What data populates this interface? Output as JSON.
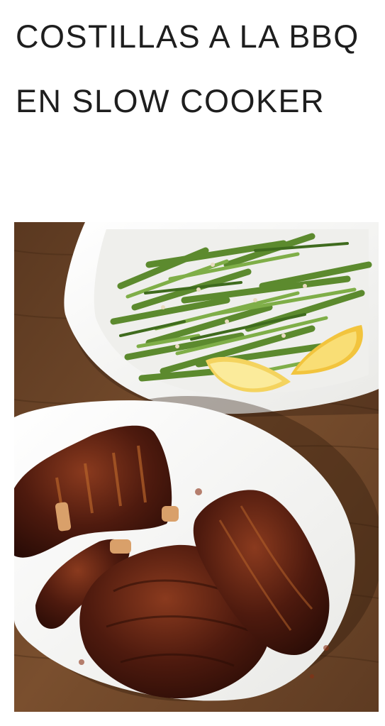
{
  "recipe": {
    "title": "COSTILLAS A LA BBQ EN SLOW COOKER"
  },
  "photo": {
    "subject": "bbq-ribs-and-green-beans",
    "colors": {
      "wood": "#6b4528",
      "plate": "#f7f7f5",
      "ribs": "#4a1a10",
      "beans": "#6f9a3a",
      "lemon": "#f4d35e"
    }
  }
}
